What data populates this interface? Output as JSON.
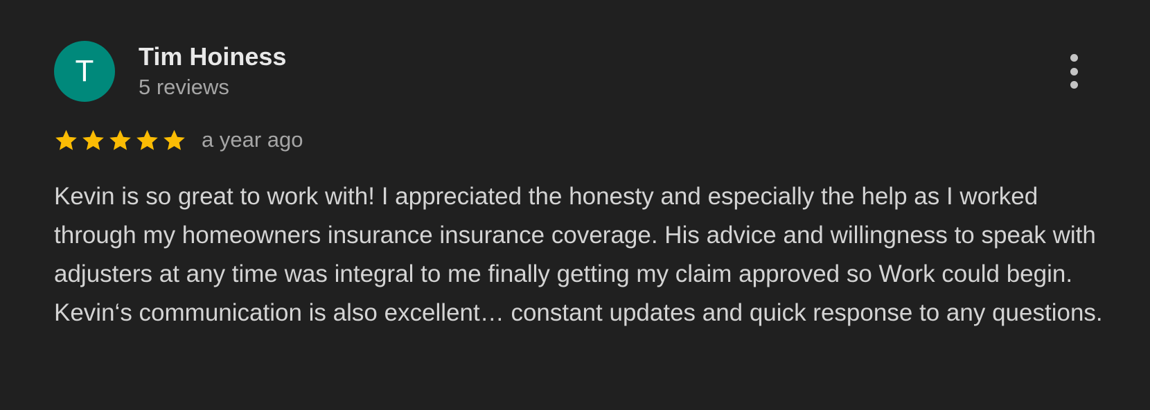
{
  "review": {
    "avatar_initial": "T",
    "reviewer_name": "Tim Hoiness",
    "review_count": "5 reviews",
    "rating": 5,
    "rating_max": 5,
    "timestamp": "a year ago",
    "text": "Kevin is so great to work with! I appreciated the honesty and especially the help as I worked through my homeowners insurance insurance coverage. His advice and willingness to speak with adjusters at any time was integral to me finally getting my claim approved so Work could begin. Kevin‘s communication is also excellent… constant updates and quick response to any questions."
  },
  "colors": {
    "background": "#202020",
    "avatar": "#00897b",
    "star": "#fbbc04",
    "name": "#e8e8e8",
    "secondary_text": "#a6a6a6",
    "body_text": "#d4d4d4"
  },
  "icons": {
    "more": "more-vert-icon",
    "star": "star-icon"
  }
}
